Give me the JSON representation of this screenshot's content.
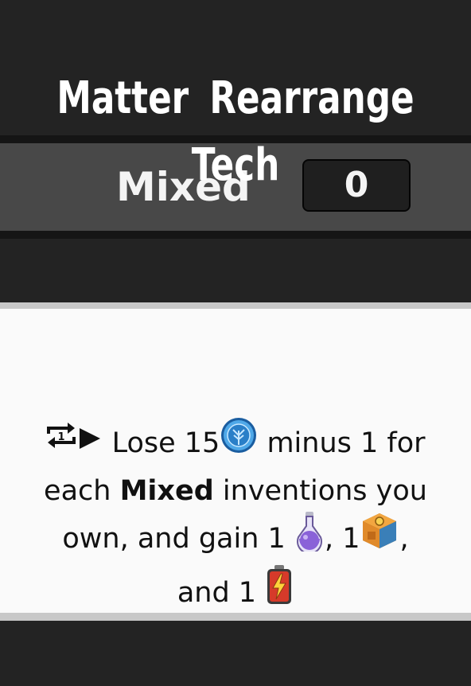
{
  "card": {
    "title": "Matter Rearrange Tech",
    "type_label": "Mixed",
    "owned_count": "0"
  },
  "effect": {
    "trigger_icons": [
      "repeat-once-icon",
      "play-arrow-icon"
    ],
    "text_1": " Lose 15",
    "cost_icon": "tech-research-coin-icon",
    "text_2": " minus 1 for each ",
    "keyword": "Mixed",
    "text_3": " inventions you own, and gain 1 ",
    "reward_icon_1": "potion-flask-icon",
    "text_4": ", 1",
    "reward_icon_2": "gear-crate-icon",
    "text_5": ", and 1 ",
    "reward_icon_3": "energy-battery-icon"
  },
  "colors": {
    "background": "#232323",
    "type_bar": "#484848",
    "panel": "#fafafa",
    "coin": "#2a7fc8",
    "potion": "#8a62d8",
    "crate": "#e08a2a",
    "battery": "#d63a2a"
  }
}
